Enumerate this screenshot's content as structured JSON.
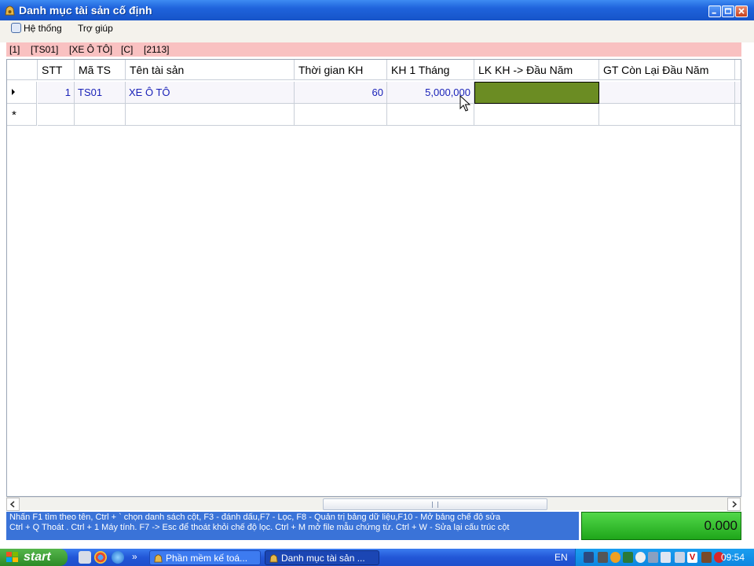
{
  "window": {
    "title": "Danh mục tài sản cố định",
    "colors": {
      "title_bar": "#1f63dc",
      "info_bar": "#f9c1c1",
      "selected_cell": "#6b8c23",
      "status_panel": "#3a73d8",
      "total_panel": "#2fbf2a"
    }
  },
  "menu": {
    "items": [
      {
        "label": "Hệ thống",
        "icon": "system-icon"
      },
      {
        "label": "Trợ giúp"
      }
    ]
  },
  "infobar": {
    "items": [
      "[1]",
      "[TS01]",
      "[XE Ô TÔ]",
      "[C]",
      "[2113]"
    ]
  },
  "grid": {
    "columns": [
      "STT",
      "Mã TS",
      "Tên tài sản",
      "Thời gian KH",
      "KH 1 Tháng",
      "LK KH -> Đầu Năm",
      "GT Còn Lại Đầu Năm"
    ],
    "rows": [
      {
        "stt": "1",
        "ma_ts": "TS01",
        "ten_ts": "XE Ô TÔ",
        "thoi_gian_kh": "60",
        "kh_1_thang": "5,000,000",
        "lk_kh": "",
        "gt_con_lai": ""
      }
    ],
    "new_row_marker": "*"
  },
  "status": {
    "help_line_1": "Nhấn F1 tìm theo tên, Ctrl + ` chọn danh sách cột, F3 - đánh dấu,F7 - Lọc, F8 - Quản trị bảng dữ liệu,F10 - Mở bảng chế độ sửa",
    "help_line_2": "Ctrl + Q Thoát . Ctrl + 1 Máy tính. F7 -> Esc để thoát khỏi chế độ lọc. Ctrl + M mở file mẫu chứng từ. Ctrl + W - Sửa lại cấu trúc cột",
    "total": "0.000"
  },
  "taskbar": {
    "start_label": "start",
    "tasks": [
      {
        "label": "Phần mềm kế toá...",
        "active": false
      },
      {
        "label": "Danh mục tài sản ...",
        "active": true
      }
    ],
    "quicklaunch_more": "»",
    "language": "EN",
    "clock": "09:54"
  }
}
